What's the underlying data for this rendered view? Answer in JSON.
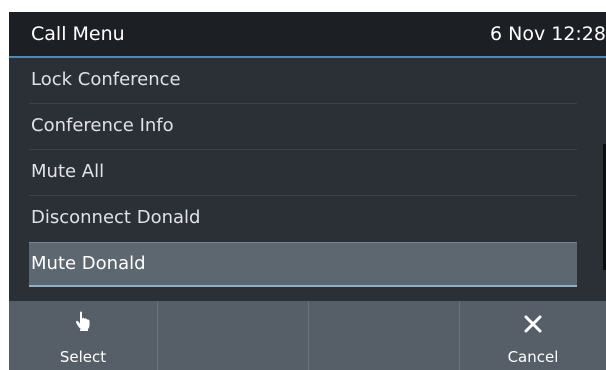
{
  "header": {
    "title": "Call Menu",
    "datetime": "6 Nov 12:28"
  },
  "menu": {
    "items": [
      {
        "label": "Lock Conference"
      },
      {
        "label": "Conference Info"
      },
      {
        "label": "Mute All"
      },
      {
        "label": "Disconnect Donald"
      },
      {
        "label": "Mute Donald"
      }
    ],
    "selected_index": 4
  },
  "softkeys": [
    {
      "label": "Select",
      "icon": "hand-pointer-icon"
    },
    {
      "label": ""
    },
    {
      "label": ""
    },
    {
      "label": "Cancel",
      "icon": "close-icon"
    }
  ],
  "colors": {
    "background": "#2b2f36",
    "header": "#1c1f24",
    "accent": "#4f88b6",
    "selected": "#5d6770",
    "softkey_bar": "#565f68"
  }
}
